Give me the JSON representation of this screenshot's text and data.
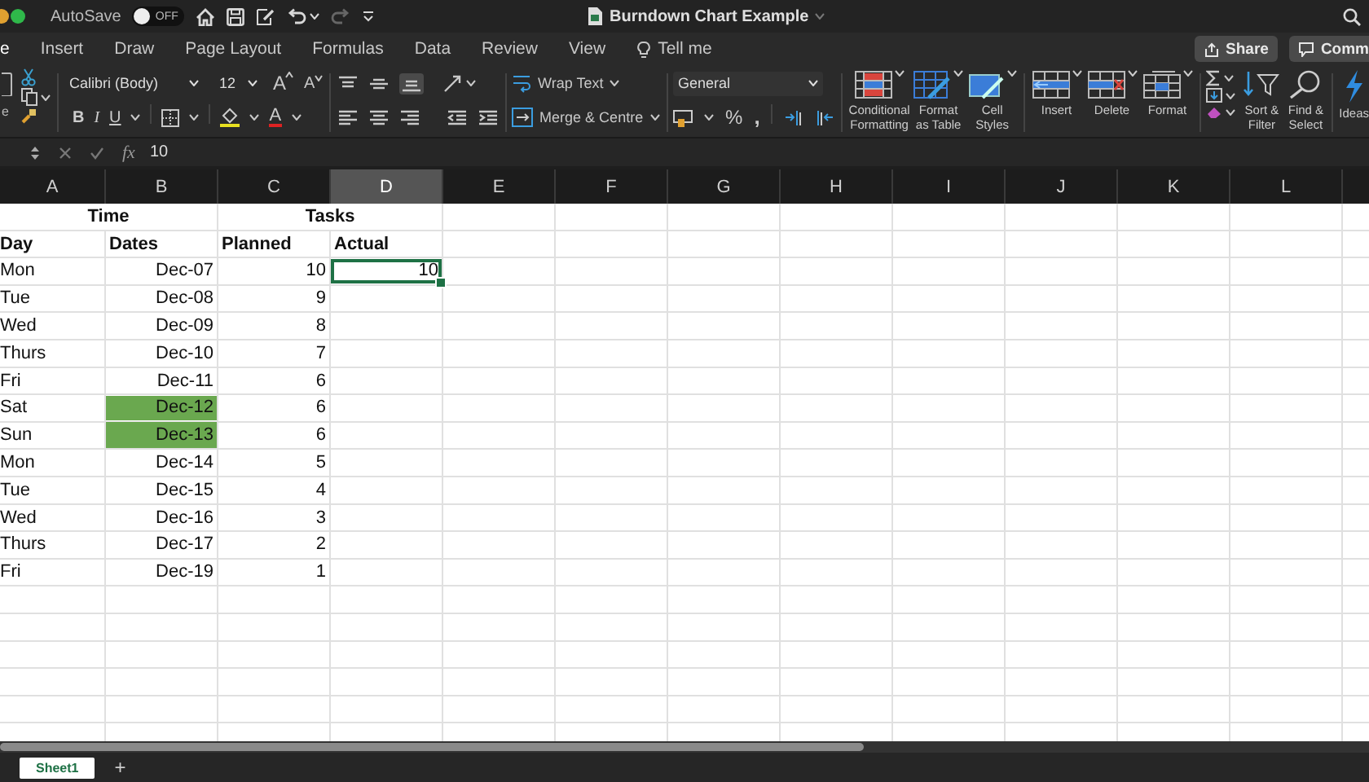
{
  "title_bar": {
    "autosave_label": "AutoSave",
    "autosave_toggle": {
      "label": "OFF",
      "on": false
    },
    "document_title": "Burndown Chart Example"
  },
  "menu_tabs": [
    {
      "label": "e",
      "selected": true
    },
    {
      "label": "Insert",
      "selected": false
    },
    {
      "label": "Draw",
      "selected": false
    },
    {
      "label": "Page Layout",
      "selected": false
    },
    {
      "label": "Formulas",
      "selected": false
    },
    {
      "label": "Data",
      "selected": false
    },
    {
      "label": "Review",
      "selected": false
    },
    {
      "label": "View",
      "selected": false
    }
  ],
  "tell_me_label": "Tell me",
  "share_button": "Share",
  "comments_button": "Comm",
  "ribbon": {
    "paste_label": "e",
    "font_name": "Calibri (Body)",
    "font_size": "12",
    "grow_font_button": "A",
    "shrink_font_button": "A",
    "style_buttons": [
      "B",
      "I",
      "U"
    ],
    "font_color_button": "A",
    "wrap_text_button": "Wrap Text",
    "merge_button": "Merge & Centre",
    "number_format": "General",
    "percent_button": "%",
    "comma_button": ",",
    "large_buttons": [
      {
        "kind": "conditional-formatting",
        "label": "Conditional\nFormatting"
      },
      {
        "kind": "format-as-table",
        "label": "Format\nas Table"
      },
      {
        "kind": "cell-styles",
        "label": "Cell\nStyles"
      },
      {
        "kind": "insert",
        "label": "Insert"
      },
      {
        "kind": "delete",
        "label": "Delete"
      },
      {
        "kind": "format",
        "label": "Format"
      },
      {
        "kind": "sort-filter",
        "label": "Sort &\nFilter"
      },
      {
        "kind": "find-select",
        "label": "Find &\nSelect"
      }
    ],
    "ideas_button": "Ideas"
  },
  "formula_bar": {
    "function_label": "fx",
    "value": "10"
  },
  "sheet": {
    "columns": [
      {
        "label": "A",
        "selected": false
      },
      {
        "label": "B",
        "selected": false
      },
      {
        "label": "C",
        "selected": false
      },
      {
        "label": "D",
        "selected": true
      },
      {
        "label": "E",
        "selected": false
      },
      {
        "label": "F",
        "selected": false
      },
      {
        "label": "G",
        "selected": false
      },
      {
        "label": "H",
        "selected": false
      },
      {
        "label": "I",
        "selected": false
      },
      {
        "label": "J",
        "selected": false
      },
      {
        "label": "K",
        "selected": false
      },
      {
        "label": "L",
        "selected": false
      }
    ],
    "group_headers": [
      "Time",
      "Tasks"
    ],
    "header_row": [
      "Day",
      "Dates",
      "Planned",
      "Actual"
    ],
    "rows": [
      {
        "day": "Mon",
        "date": "Dec-07",
        "planned": "10",
        "actual": "10",
        "date_highlighted": false,
        "actual_selected": true
      },
      {
        "day": "Tue",
        "date": "Dec-08",
        "planned": "9",
        "date_highlighted": false,
        "actual_selected": false
      },
      {
        "day": "Wed",
        "date": "Dec-09",
        "planned": "8",
        "date_highlighted": false,
        "actual_selected": false
      },
      {
        "day": "Thurs",
        "date": "Dec-10",
        "planned": "7",
        "date_highlighted": false,
        "actual_selected": false
      },
      {
        "day": "Fri",
        "date": "Dec-11",
        "planned": "6",
        "date_highlighted": false,
        "actual_selected": false
      },
      {
        "day": "Sat",
        "date": "Dec-12",
        "planned": "6",
        "date_highlighted": true,
        "actual_selected": false
      },
      {
        "day": "Sun",
        "date": "Dec-13",
        "planned": "6",
        "date_highlighted": true,
        "actual_selected": false
      },
      {
        "day": "Mon",
        "date": "Dec-14",
        "planned": "5",
        "date_highlighted": false,
        "actual_selected": false
      },
      {
        "day": "Tue",
        "date": "Dec-15",
        "planned": "4",
        "date_highlighted": false,
        "actual_selected": false
      },
      {
        "day": "Wed",
        "date": "Dec-16",
        "planned": "3",
        "date_highlighted": false,
        "actual_selected": false
      },
      {
        "day": "Thurs",
        "date": "Dec-17",
        "planned": "2",
        "date_highlighted": false,
        "actual_selected": false
      },
      {
        "day": "Fri",
        "date": "Dec-19",
        "planned": "1",
        "date_highlighted": false,
        "actual_selected": false
      }
    ]
  },
  "sheet_tabs": [
    {
      "label": "Sheet1",
      "selected": true
    }
  ],
  "add_sheet_button": "+"
}
